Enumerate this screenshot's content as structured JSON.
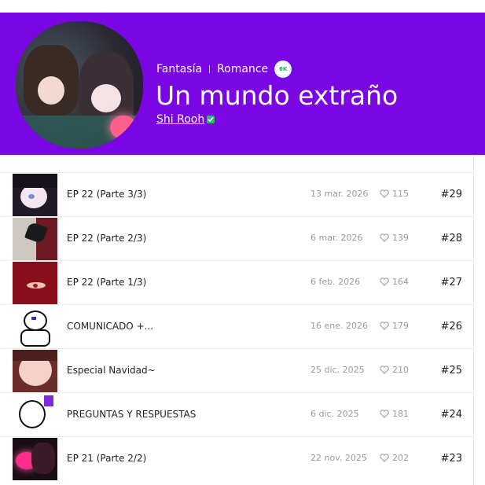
{
  "series": {
    "genres": [
      "Fantasía",
      "Romance"
    ],
    "views_badge": "6K",
    "title": "Un mundo extraño",
    "author": "Shi Rooh"
  },
  "colors": {
    "header_bg": "#7a06e4",
    "verified": "#2fbf5f"
  },
  "episodes": [
    {
      "title": "EP 22 (Parte 3/3)",
      "date": "13 mar. 2026",
      "likes": "115",
      "number": "#29",
      "thumb": "dark-hair-girl"
    },
    {
      "title": "EP 22 (Parte 2/3)",
      "date": "6 mar. 2026",
      "likes": "139",
      "number": "#28",
      "thumb": "butterfly"
    },
    {
      "title": "EP 22 (Parte 1/3)",
      "date": "6 feb. 2026",
      "likes": "164",
      "number": "#27",
      "thumb": "red-eye"
    },
    {
      "title": "COMUNICADO +...",
      "date": "16 ene. 2026",
      "likes": "179",
      "number": "#26",
      "thumb": "sketch"
    },
    {
      "title": "Especial Navidad~",
      "date": "25 dic. 2025",
      "likes": "210",
      "number": "#25",
      "thumb": "christmas"
    },
    {
      "title": "PREGUNTAS Y RESPUESTAS",
      "date": "6 dic. 2025",
      "likes": "181",
      "number": "#24",
      "thumb": "qa-sketch"
    },
    {
      "title": "EP 21 (Parte 2/2)",
      "date": "22 nov. 2025",
      "likes": "202",
      "number": "#23",
      "thumb": "pink-glow"
    }
  ]
}
